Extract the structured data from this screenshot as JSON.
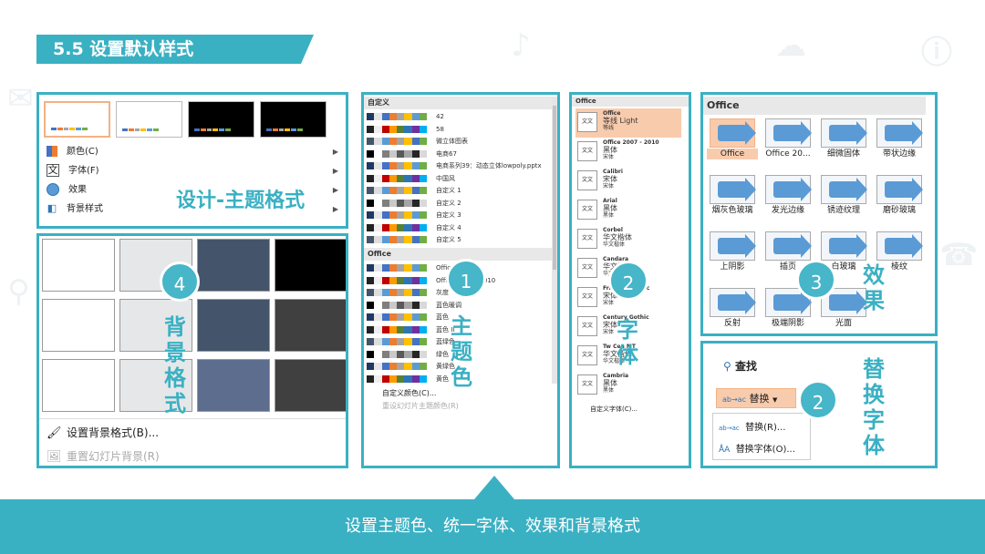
{
  "header": {
    "title": "5.5  设置默认样式"
  },
  "design_panel": {
    "menu": [
      {
        "label": "颜色(C)",
        "icon": "color-icon"
      },
      {
        "label": "字体(F)",
        "icon": "font-icon"
      },
      {
        "label": "效果",
        "icon": "effects-icon"
      },
      {
        "label": "背景样式",
        "icon": "background-style-icon"
      }
    ],
    "caption": "设计-主题格式"
  },
  "background_panel": {
    "caption": "背景格式",
    "badge": "4",
    "format_background_label": "设置背景格式(B)...",
    "reset_background_label": "重置幻灯片背景(R)",
    "cells": [
      "#ffffff",
      "#e6e7e8",
      "#44546a",
      "#000000",
      "#ffffff",
      "#e6e7e8",
      "#44546a",
      "#404040",
      "#ffffff",
      "#e6e7e8",
      "#5d6d8e",
      "#404040"
    ]
  },
  "colors_panel": {
    "custom_header": "自定义",
    "custom_items": [
      "42",
      "58",
      "微立体图表",
      "电商67",
      "电商系列39：动态立体lowpoly.pptx",
      "中国风",
      "自定义 1",
      "自定义 2",
      "自定义 3",
      "自定义 4",
      "自定义 5"
    ],
    "office_header": "Office",
    "office_items": [
      "Office",
      "Office 2007 - 2010",
      "灰度",
      "蓝色暖调",
      "蓝色",
      "蓝色 II",
      "蓝绿色",
      "绿色",
      "黄绿色",
      "黄色"
    ],
    "custom_colors_label": "自定义颜色(C)...",
    "reset_colors_label": "重设幻灯片主题颜色(R)",
    "caption": "主题色",
    "badge": "1"
  },
  "fonts_panel": {
    "header": "Office",
    "items": [
      {
        "sample": "文文",
        "name": "Office",
        "line1": "等线 Light",
        "line2": "等线"
      },
      {
        "sample": "文文",
        "name": "Office 2007 - 2010",
        "line1": "黑体",
        "line2": "宋体"
      },
      {
        "sample": "文文",
        "name": "Calibri",
        "line1": "宋体",
        "line2": "宋体"
      },
      {
        "sample": "文文",
        "name": "Arial",
        "line1": "黑体",
        "line2": "黑体"
      },
      {
        "sample": "文文",
        "name": "Corbel",
        "line1": "华文楷体",
        "line2": "华文楷体"
      },
      {
        "sample": "文文",
        "name": "Candara",
        "line1": "华文楷体",
        "line2": "华文楷体"
      },
      {
        "sample": "文文",
        "name": "Franklin Gothic",
        "line1": "宋体",
        "line2": "宋体"
      },
      {
        "sample": "文文",
        "name": "Century Gothic",
        "line1": "宋体",
        "line2": "宋体"
      },
      {
        "sample": "文文",
        "name": "Tw Cen MT",
        "line1": "华文楷体",
        "line2": "华文楷体"
      },
      {
        "sample": "文文",
        "name": "Cambria",
        "line1": "黑体",
        "line2": "黑体"
      }
    ],
    "custom_fonts_label": "自定义字体(C)...",
    "caption": "字体",
    "badge": "2"
  },
  "effects_panel": {
    "header": "Office",
    "items": [
      "Office",
      "Office 20...",
      "细微固体",
      "带状边缘",
      "烟灰色玻璃",
      "发光边缘",
      "锈迹纹理",
      "磨砂玻璃",
      "上阴影",
      "插页",
      "白玻璃",
      "棱纹",
      "反射",
      "极端阴影",
      "光面"
    ],
    "caption": "效果",
    "badge": "3"
  },
  "replace_panel": {
    "find_label": "查找",
    "replace_label": "替换",
    "menu": [
      "替换(R)...",
      "替换字体(O)..."
    ],
    "caption": "替换字体",
    "badge": "2"
  },
  "footer": {
    "caption": "设置主题色、统一字体、效果和背景格式"
  },
  "colors": {
    "accent": "#3ab0c3",
    "highlight": "#f4b183"
  }
}
